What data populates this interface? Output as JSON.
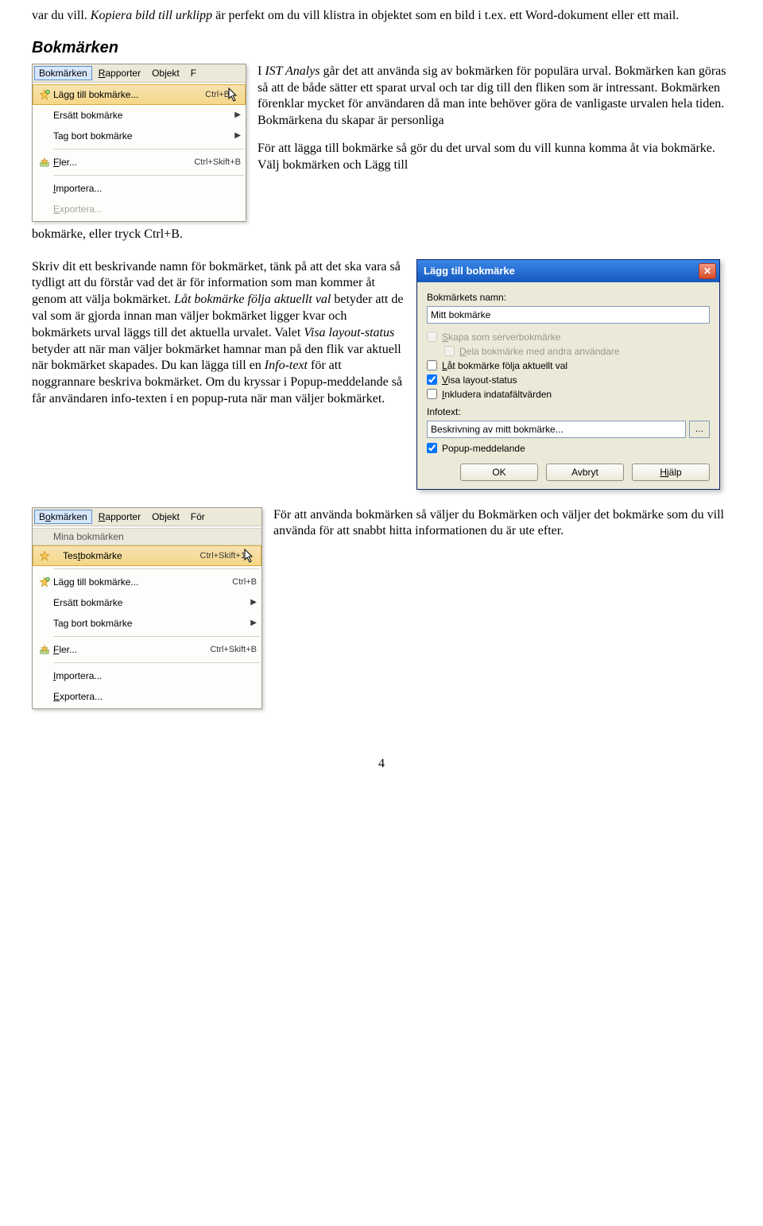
{
  "intro_paragraph_prefix": "var du vill. ",
  "intro_italic": "Kopiera bild till urklipp",
  "intro_paragraph_suffix": " är perfekt om du vill klistra in objektet som en bild i t.ex. ett Word-dokument eller ett mail.",
  "section_heading": "Bokmärken",
  "menu1": {
    "bar": {
      "bokmarken": "Bokmärken",
      "rapporter": "Rapporter",
      "objekt": "Objekt",
      "extra": "F"
    },
    "items": {
      "lagg_till": {
        "label": "Lägg till bokmärke...",
        "shortcut": "Ctrl+B"
      },
      "ersatt": {
        "label": "Ersätt bokmärke"
      },
      "ta_bort": {
        "label": "Tag bort bokmärke"
      },
      "fler": {
        "label": "Fler...",
        "shortcut": "Ctrl+Skift+B"
      },
      "importera": {
        "label": "Importera..."
      },
      "exportera": {
        "label": "Exportera..."
      }
    }
  },
  "right_para_1_prefix": "I ",
  "right_para_1_italic": "IST Analys",
  "right_para_1_suffix": " går det att använda sig av bokmärken för populära urval. Bokmärken kan göras så att de både sätter ett sparat urval och tar dig till den fliken som är intressant. Bokmärken förenklar mycket för användaren då man inte behöver göra de vanligaste urvalen hela tiden. Bokmärkena du skapar är personliga",
  "right_para_2": "För att lägga till bokmärke så gör du det urval som du vill kunna komma åt via bokmärke. Välj bokmärken och Lägg till",
  "below_menu1": "bokmärke, eller tryck Ctrl+B.",
  "left_long_para": {
    "p1": "Skriv dit ett beskrivande namn för bokmärket, tänk på att det ska vara så tydligt att du förstår vad det är för information som man kommer åt genom att välja bokmärket. ",
    "italic1": "Låt bokmärke följa aktuellt val",
    "p2": " betyder att de val som är gjorda innan man väljer bokmärket ligger kvar och bokmärkets urval läggs till det aktuella urvalet. Valet ",
    "italic2": "Visa layout-status",
    "p3": " betyder att när man väljer bokmärket hamnar man på den flik var aktuell när bokmärket skapades. Du kan lägga till en ",
    "italic3": "Info-text",
    "p4": " för att noggrannare beskriva bokmärket. Om du kryssar i Popup-meddelande så får användaren info-texten i en popup-ruta när man väljer bokmärket."
  },
  "dialog": {
    "title": "Lägg till bokmärke",
    "name_label": "Bokmärkets namn:",
    "name_value": "Mitt bokmärke",
    "chk_server": "Skapa som serverbokmärke",
    "chk_share": "Dela bokmärke med andra användare",
    "chk_follow": "Låt bokmärke följa aktuellt val",
    "chk_layout": "Visa layout-status",
    "chk_include": "Inkludera indatafältvärden",
    "info_label": "Infotext:",
    "info_value": "Beskrivning av mitt bokmärke...",
    "chk_popup": "Popup-meddelande",
    "btn_ok": "OK",
    "btn_cancel": "Avbryt",
    "btn_help": "Hjälp"
  },
  "menu2": {
    "bar": {
      "bokmarken": "Bokmärken",
      "rapporter": "Rapporter",
      "objekt": "Objekt",
      "extra": "För"
    },
    "header": "Mina bokmärken",
    "items": {
      "testbokmarke": {
        "label": "Testbokmärke",
        "shortcut": "Ctrl+Skift+1"
      },
      "lagg_till": {
        "label": "Lägg till bokmärke...",
        "shortcut": "Ctrl+B"
      },
      "ersatt": {
        "label": "Ersätt bokmärke"
      },
      "ta_bort": {
        "label": "Tag bort bokmärke"
      },
      "fler": {
        "label": "Fler...",
        "shortcut": "Ctrl+Skift+B"
      },
      "importera": {
        "label": "Importera..."
      },
      "exportera": {
        "label": "Exportera..."
      }
    }
  },
  "right_of_menu2": "För att använda bokmärken så väljer du Bokmärken och väljer det bokmärke som du vill använda för att snabbt hitta informationen du är ute efter.",
  "page_number": "4"
}
